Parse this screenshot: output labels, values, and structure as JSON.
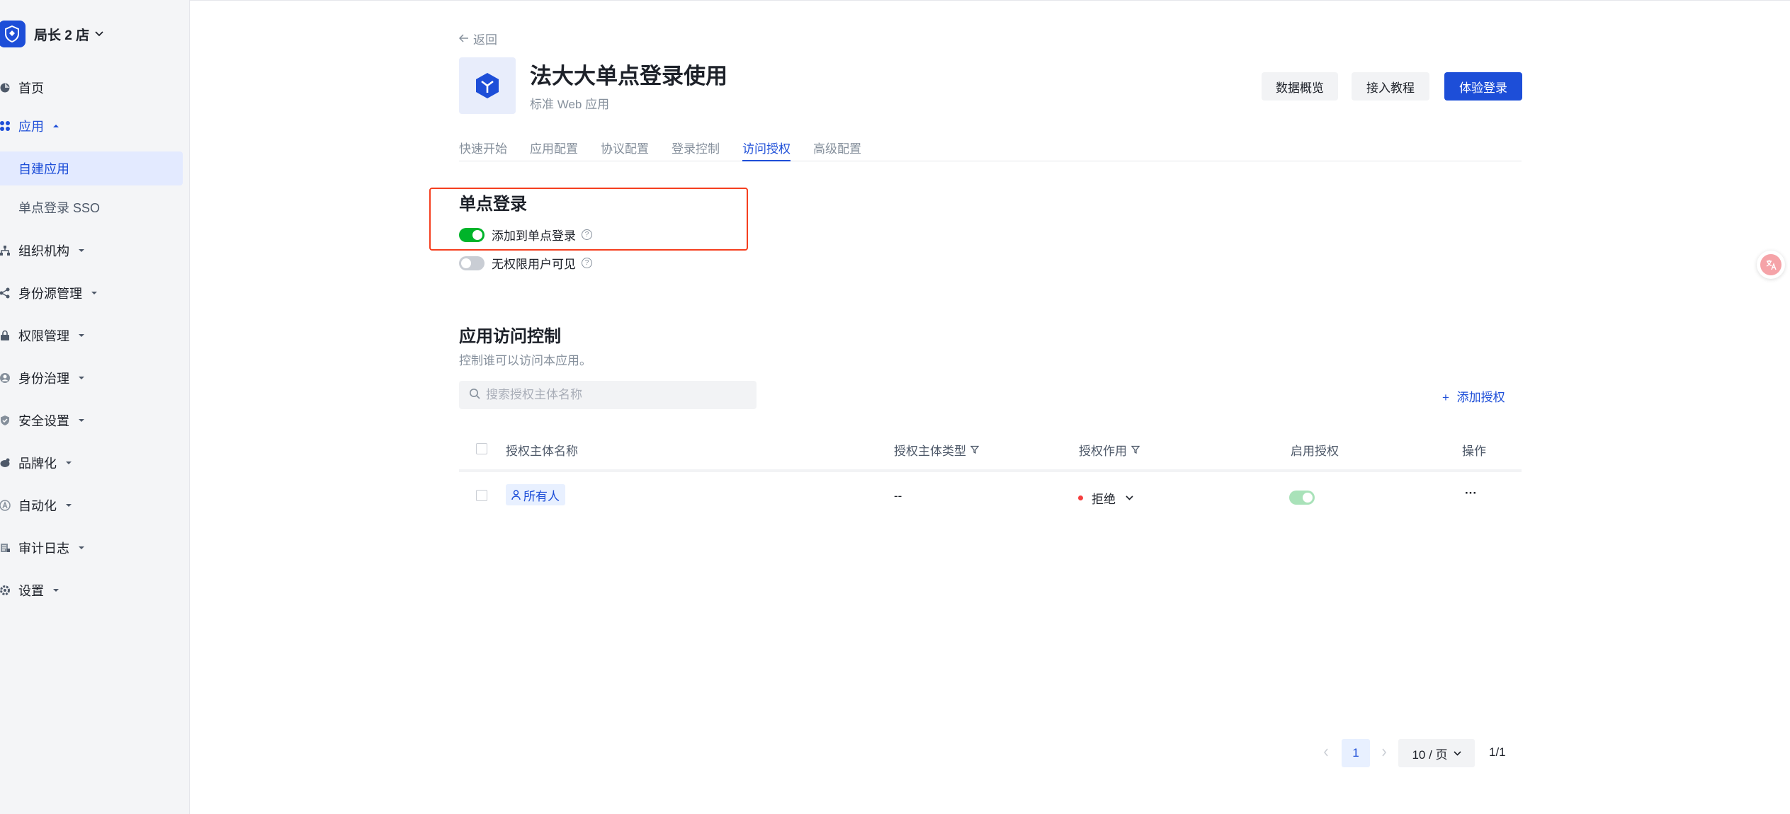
{
  "colors": {
    "primary": "#1d4ed8",
    "success": "#00b42a",
    "danger": "#f53f3f",
    "highlight": "#f53f1f"
  },
  "sidebar": {
    "brand": "局长 2 店",
    "items": [
      {
        "label": "首页",
        "icon": "home-icon"
      },
      {
        "label": "应用",
        "icon": "apps-icon"
      },
      {
        "label": "组织机构",
        "icon": "org-icon"
      },
      {
        "label": "身份源管理",
        "icon": "share-icon"
      },
      {
        "label": "权限管理",
        "icon": "lock-icon"
      },
      {
        "label": "身份治理",
        "icon": "identity-icon"
      },
      {
        "label": "安全设置",
        "icon": "shield-icon"
      },
      {
        "label": "品牌化",
        "icon": "brand-icon"
      },
      {
        "label": "自动化",
        "icon": "automation-icon"
      },
      {
        "label": "审计日志",
        "icon": "log-icon"
      },
      {
        "label": "设置",
        "icon": "gear-icon"
      }
    ],
    "sub_items": [
      {
        "label": "自建应用"
      },
      {
        "label": "单点登录 SSO"
      }
    ]
  },
  "header": {
    "back": "返回",
    "title": "法大大单点登录使用",
    "subtitle": "标准 Web 应用",
    "buttons": {
      "overview": "数据概览",
      "tutorial": "接入教程",
      "try_login": "体验登录"
    }
  },
  "tabs": [
    {
      "label": "快速开始"
    },
    {
      "label": "应用配置"
    },
    {
      "label": "协议配置"
    },
    {
      "label": "登录控制"
    },
    {
      "label": "访问授权"
    },
    {
      "label": "高级配置"
    }
  ],
  "sso": {
    "title": "单点登录",
    "add_to_sso": "添加到单点登录",
    "add_to_sso_on": true,
    "visible_to_unauthorized": "无权限用户可见",
    "visible_to_unauthorized_on": false
  },
  "access": {
    "title": "应用访问控制",
    "desc": "控制谁可以访问本应用。",
    "search_placeholder": "搜索授权主体名称",
    "add_button": "添加授权",
    "columns": {
      "name": "授权主体名称",
      "type": "授权主体类型",
      "effect": "授权作用",
      "enabled": "启用授权",
      "actions": "操作"
    },
    "rows": [
      {
        "name": "所有人",
        "type": "--",
        "effect": "拒绝",
        "enabled": true,
        "actions": "···"
      }
    ]
  },
  "pagination": {
    "current": "1",
    "page_size": "10 / 页",
    "total": "1/1"
  }
}
